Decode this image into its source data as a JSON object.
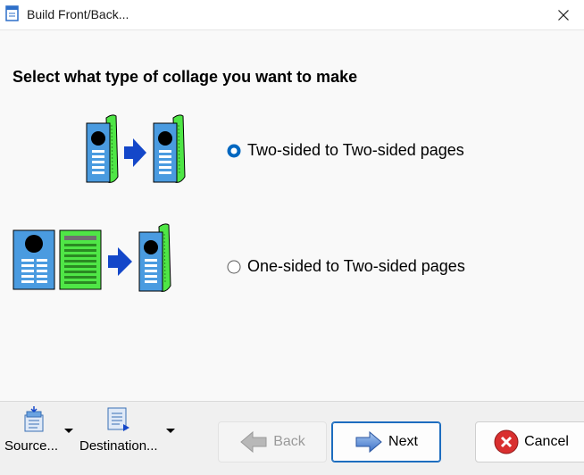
{
  "window": {
    "title": "Build Front/Back...",
    "icon": "document-icon",
    "close_icon": "close-icon"
  },
  "heading": "Select what type of collage you want to make",
  "options": [
    {
      "label": "Two-sided to Two-sided pages",
      "selected": true
    },
    {
      "label": "One-sided to Two-sided pages",
      "selected": false
    }
  ],
  "toolbar": {
    "source_label": "Source...",
    "destination_label": "Destination..."
  },
  "buttons": {
    "back": "Back",
    "next": "Next",
    "cancel": "Cancel"
  },
  "colors": {
    "accent": "#0067c0",
    "page_blue": "#4a9be0",
    "page_green": "#4fe646",
    "arrow_blue": "#1447c9",
    "cancel_red": "#d92f2f"
  }
}
